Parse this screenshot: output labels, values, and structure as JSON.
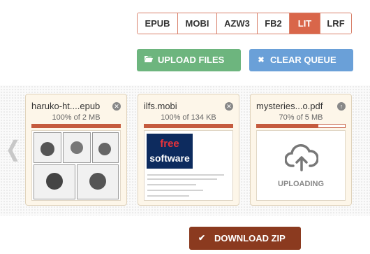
{
  "formats": [
    {
      "label": "EPUB",
      "active": false
    },
    {
      "label": "MOBI",
      "active": false
    },
    {
      "label": "AZW3",
      "active": false
    },
    {
      "label": "FB2",
      "active": false
    },
    {
      "label": "LIT",
      "active": true
    },
    {
      "label": "LRF",
      "active": false
    }
  ],
  "actions": {
    "upload_label": "UPLOAD FILES",
    "upload_icon": "folder-open-icon",
    "clear_label": "CLEAR QUEUE",
    "clear_icon": "close-icon"
  },
  "files": [
    {
      "name": "haruko-ht....epub",
      "status": "100% of 2 MB",
      "progress": 1.0,
      "state": "done",
      "action_icon": "remove-icon"
    },
    {
      "name": "ilfs.mobi",
      "status": "100% of 134 KB",
      "progress": 1.0,
      "state": "done",
      "action_icon": "remove-icon"
    },
    {
      "name": "mysteries...o.pdf",
      "status": "70% of 5 MB",
      "progress": 0.7,
      "state": "uploading",
      "action_icon": "upload-arrow-icon",
      "uploading_label": "UPLOADING"
    }
  ],
  "ilfs_logo": {
    "line1": "free",
    "line2": "software"
  },
  "download": {
    "label": "DOWNLOAD ZIP",
    "icon": "check-icon"
  },
  "colors": {
    "accent": "#d9664a",
    "upload": "#6db57e",
    "clear": "#6aa0d8",
    "download": "#8b3a1f",
    "progress": "#c55b3e"
  }
}
